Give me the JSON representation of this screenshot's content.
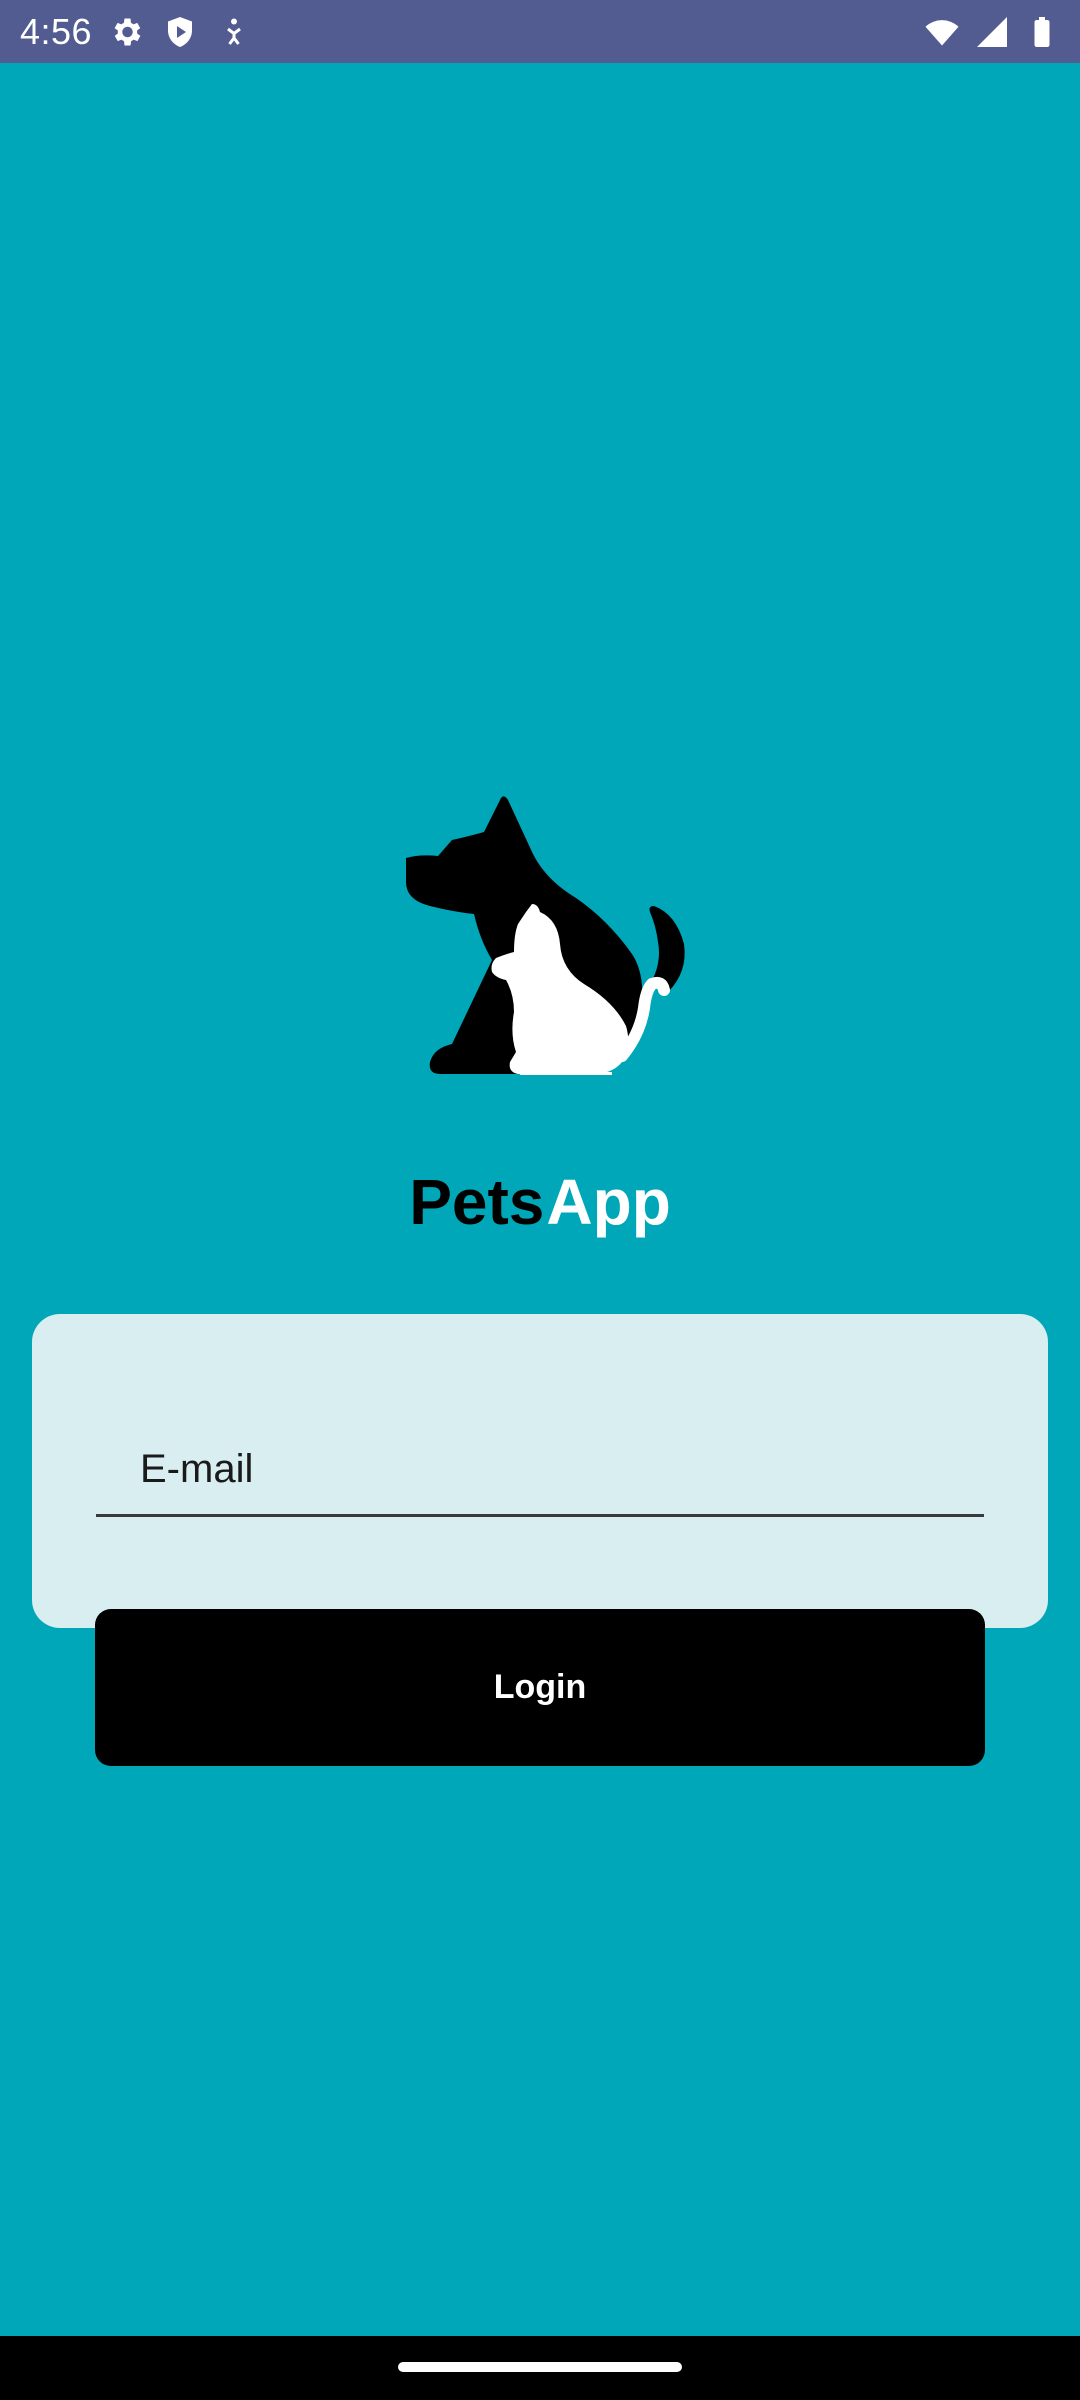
{
  "status_bar": {
    "time": "4:56",
    "left_icons": [
      "gear-icon",
      "shield-play-icon",
      "accessibility-icon"
    ],
    "right_icons": [
      "wifi-icon",
      "cell-signal-icon",
      "battery-icon"
    ],
    "background": "#525c91"
  },
  "app": {
    "title_part_1": "Pets",
    "title_part_2": "App",
    "logo": "dog-and-cat-silhouette",
    "background": "#00a7b8"
  },
  "login_form": {
    "email_placeholder": "E-mail",
    "email_value": "",
    "login_label": "Login",
    "card_color": "#d9eef1"
  }
}
